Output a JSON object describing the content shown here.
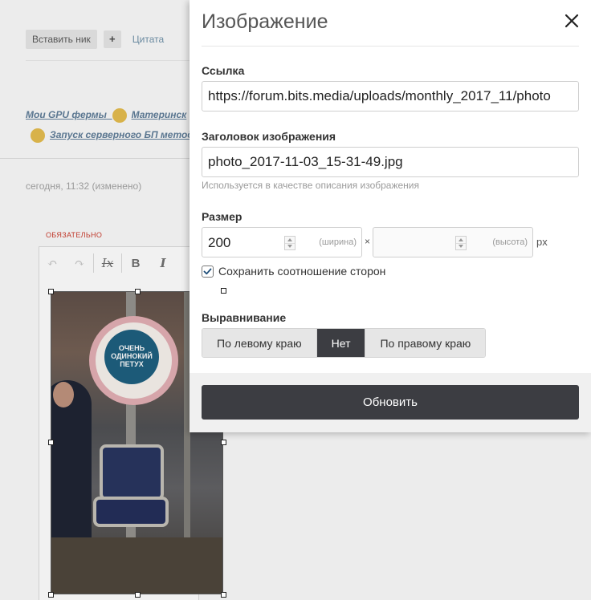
{
  "background": {
    "toolbar": {
      "insert_nick_label": "Вставить ник",
      "plus_label": "+",
      "quote_label": "Цитата"
    },
    "signature": {
      "line1_link1": "Мои GPU фермы",
      "line1_link2": "Материнск",
      "line2_link": "Запуск серверного БП метод"
    },
    "post_date": "сегодня, 11:32 (изменено)",
    "required_label": "ОБЯЗАТЕЛЬНО",
    "editor_tools": {
      "undo_icon": "undo-icon",
      "redo_icon": "redo-icon",
      "clear_format": "Ix",
      "bold": "B",
      "italic": "I"
    },
    "photo_badge": "ОЧЕНЬ ОДИНОКИЙ ПЕТУХ"
  },
  "modal": {
    "title": "Изображение",
    "close_icon": "close-icon",
    "link": {
      "label": "Ссылка",
      "value": "https://forum.bits.media/uploads/monthly_2017_11/photo"
    },
    "caption": {
      "label": "Заголовок изображения",
      "value": "photo_2017-11-03_15-31-49.jpg",
      "hint": "Используется в качестве описания изображения"
    },
    "size": {
      "label": "Размер",
      "width_value": "200",
      "width_suffix": "(ширина)",
      "times": "×",
      "height_value": "",
      "height_suffix": "(высота)",
      "unit": "px"
    },
    "keep_ratio": {
      "label": "Сохранить соотношение сторон",
      "checked": true
    },
    "alignment": {
      "label": "Выравнивание",
      "options": [
        {
          "label": "По левому краю",
          "active": false
        },
        {
          "label": "Нет",
          "active": true
        },
        {
          "label": "По правому краю",
          "active": false
        }
      ]
    },
    "update_label": "Обновить"
  }
}
